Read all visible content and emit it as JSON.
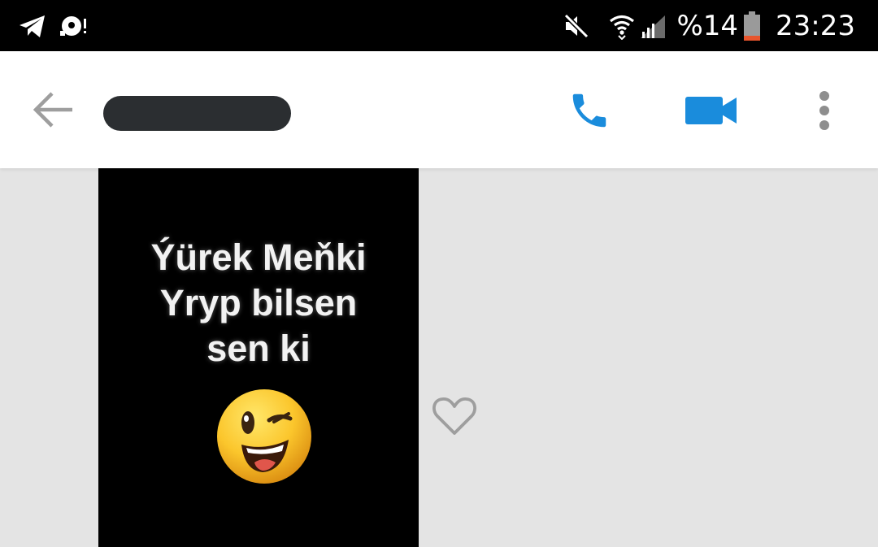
{
  "status_bar": {
    "icons": [
      "telegram-icon",
      "notification-icon",
      "mute-icon",
      "wifi-icon",
      "signal-icon",
      "battery-icon"
    ],
    "battery_percent": "%14",
    "time": "23:23",
    "battery_color": "#e8552d"
  },
  "app_bar": {
    "contact_name": "",
    "icons": [
      "back-arrow-icon",
      "phone-icon",
      "video-camera-icon",
      "more-vert-icon"
    ],
    "accent_color": "#1a8cdc"
  },
  "chat": {
    "image_message": {
      "lines": [
        "Ýürek Meňki",
        "Yryp bilsen",
        "sen ki"
      ],
      "emoji": "winking-face-with-tongue"
    },
    "like_icon": "heart-outline-icon"
  }
}
